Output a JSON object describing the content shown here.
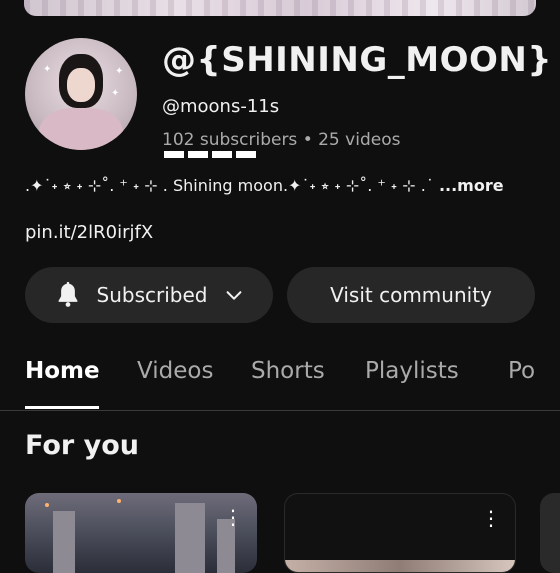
{
  "channel": {
    "title": "@{SHINING_MOON}",
    "handle": "@moons-11s",
    "stats": "102 subscribers • 25 videos",
    "description": ".✦˙˖ ⭒ ˖ ⊹˚. ⁺ ˖ ⊹ . Shining moon.✦˙˖ ⭒ ˖ ⊹˚. ⁺ ˖ ⊹ .˙",
    "more_label": "...more",
    "link": "pin.it/2lR0irjfX"
  },
  "actions": {
    "subscribed_label": "Subscribed",
    "community_label": "Visit community"
  },
  "tabs": [
    {
      "label": "Home",
      "active": true
    },
    {
      "label": "Videos",
      "active": false
    },
    {
      "label": "Shorts",
      "active": false
    },
    {
      "label": "Playlists",
      "active": false
    },
    {
      "label": "Po",
      "active": false
    }
  ],
  "section": {
    "title": "For you"
  },
  "icons": {
    "bell": "bell-icon",
    "chevron": "chevron-down-icon",
    "more": "more-vert-icon"
  }
}
